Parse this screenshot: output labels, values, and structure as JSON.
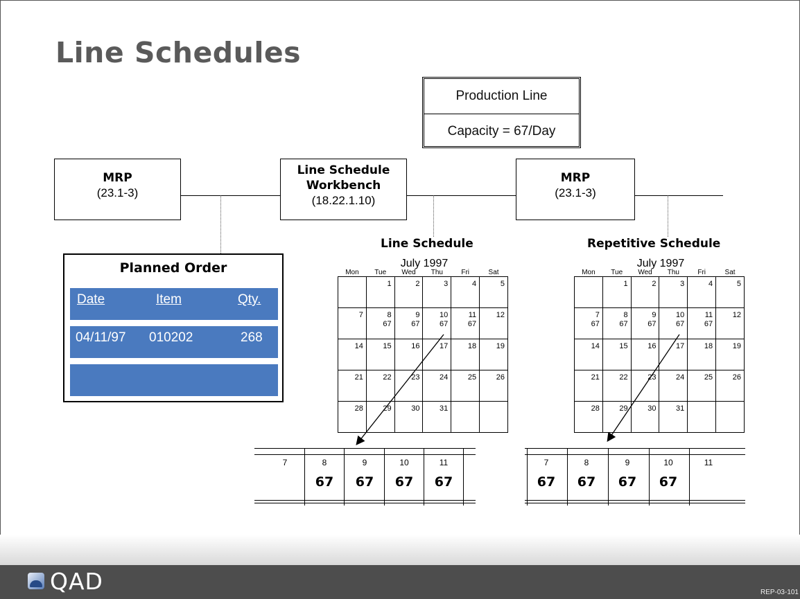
{
  "title": "Line Schedules",
  "production_line": {
    "name": "Production Line",
    "capacity": "Capacity = 67/Day"
  },
  "mrp_left": {
    "title": "MRP",
    "code": "(23.1-3)"
  },
  "workbench": {
    "title_line1": "Line Schedule",
    "title_line2": "Workbench",
    "code": "(18.22.1.10)"
  },
  "mrp_right": {
    "title": "MRP",
    "code": "(23.1-3)"
  },
  "line_schedule_label": "Line Schedule",
  "repetitive_schedule_label": "Repetitive Schedule",
  "planned_order": {
    "title": "Planned Order",
    "headers": [
      "Date",
      "Item",
      "Qty."
    ],
    "row": [
      "04/11/97",
      "010202",
      "268"
    ]
  },
  "calendar_left": {
    "month": "July 1997",
    "days": [
      "Mon",
      "Tue",
      "Wed",
      "Thu",
      "Fri",
      "Sat"
    ],
    "weeks": [
      [
        {
          "d": ""
        },
        {
          "d": "1"
        },
        {
          "d": "2"
        },
        {
          "d": "3"
        },
        {
          "d": "4"
        },
        {
          "d": "5"
        }
      ],
      [
        {
          "d": "7"
        },
        {
          "d": "8",
          "v": "67"
        },
        {
          "d": "9",
          "v": "67"
        },
        {
          "d": "10",
          "v": "67"
        },
        {
          "d": "11",
          "v": "67"
        },
        {
          "d": "12"
        }
      ],
      [
        {
          "d": "14"
        },
        {
          "d": "15"
        },
        {
          "d": "16"
        },
        {
          "d": "17"
        },
        {
          "d": "18"
        },
        {
          "d": "19"
        }
      ],
      [
        {
          "d": "21"
        },
        {
          "d": "22"
        },
        {
          "d": "23"
        },
        {
          "d": "24"
        },
        {
          "d": "25"
        },
        {
          "d": "26"
        }
      ],
      [
        {
          "d": "28"
        },
        {
          "d": "29"
        },
        {
          "d": "30"
        },
        {
          "d": "31"
        },
        {
          "d": ""
        },
        {
          "d": ""
        }
      ]
    ]
  },
  "calendar_right": {
    "month": "July 1997",
    "days": [
      "Mon",
      "Tue",
      "Wed",
      "Thu",
      "Fri",
      "Sat"
    ],
    "weeks": [
      [
        {
          "d": ""
        },
        {
          "d": "1"
        },
        {
          "d": "2"
        },
        {
          "d": "3"
        },
        {
          "d": "4"
        },
        {
          "d": "5"
        }
      ],
      [
        {
          "d": "7",
          "v": "67"
        },
        {
          "d": "8",
          "v": "67"
        },
        {
          "d": "9",
          "v": "67"
        },
        {
          "d": "10",
          "v": "67"
        },
        {
          "d": "11",
          "v": "67"
        },
        {
          "d": "12"
        }
      ],
      [
        {
          "d": "14"
        },
        {
          "d": "15"
        },
        {
          "d": "16"
        },
        {
          "d": "17"
        },
        {
          "d": "18"
        },
        {
          "d": "19"
        }
      ],
      [
        {
          "d": "21"
        },
        {
          "d": "22"
        },
        {
          "d": "23"
        },
        {
          "d": "24"
        },
        {
          "d": "25"
        },
        {
          "d": "26"
        }
      ],
      [
        {
          "d": "28"
        },
        {
          "d": "29"
        },
        {
          "d": "30"
        },
        {
          "d": "31"
        },
        {
          "d": ""
        },
        {
          "d": ""
        }
      ]
    ]
  },
  "schedule_left": {
    "days": [
      "7",
      "8",
      "9",
      "10",
      "11"
    ],
    "qty": [
      "",
      "67",
      "67",
      "67",
      "67"
    ]
  },
  "schedule_right": {
    "days": [
      "7",
      "8",
      "9",
      "10",
      "11"
    ],
    "qty": [
      "67",
      "67",
      "67",
      "67",
      ""
    ]
  },
  "footer": {
    "logo": "QAD",
    "code": "REP-03-101"
  },
  "colors": {
    "title": "#5a5a5a",
    "band": "#4a7abf",
    "footer": "#4d4d4d"
  }
}
